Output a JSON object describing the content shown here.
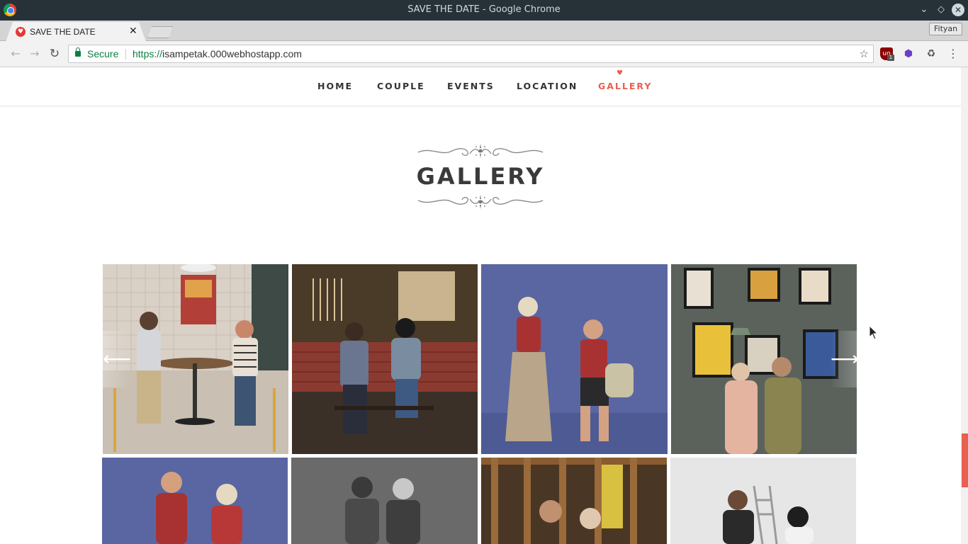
{
  "window": {
    "title": "SAVE THE DATE - Google Chrome",
    "profile_name": "Fityan"
  },
  "tab": {
    "title": "SAVE THE DATE",
    "favicon": "heart-favicon"
  },
  "toolbar": {
    "secure_label": "Secure",
    "url_scheme": "https://",
    "url_host": "isampetak.000webhostapp.com",
    "ublock_badge": "1"
  },
  "site_nav": {
    "items": [
      {
        "label": "HOME"
      },
      {
        "label": "COUPLE"
      },
      {
        "label": "EVENTS"
      },
      {
        "label": "LOCATION"
      },
      {
        "label": "GALLERY",
        "active": true
      }
    ],
    "accent_color": "#e8604f"
  },
  "gallery": {
    "title": "GALLERY",
    "prev_icon": "arrow-left-icon",
    "next_icon": "arrow-right-icon",
    "photos": [
      {
        "name": "photo-couple-cafe-table"
      },
      {
        "name": "photo-couple-brick-wall"
      },
      {
        "name": "photo-couple-blue-backdrop"
      },
      {
        "name": "photo-couple-poster-wall"
      },
      {
        "name": "photo-couple-red-shirts"
      },
      {
        "name": "photo-couple-batik"
      },
      {
        "name": "photo-couple-wooden-bars"
      },
      {
        "name": "photo-couple-white-studio"
      }
    ]
  }
}
